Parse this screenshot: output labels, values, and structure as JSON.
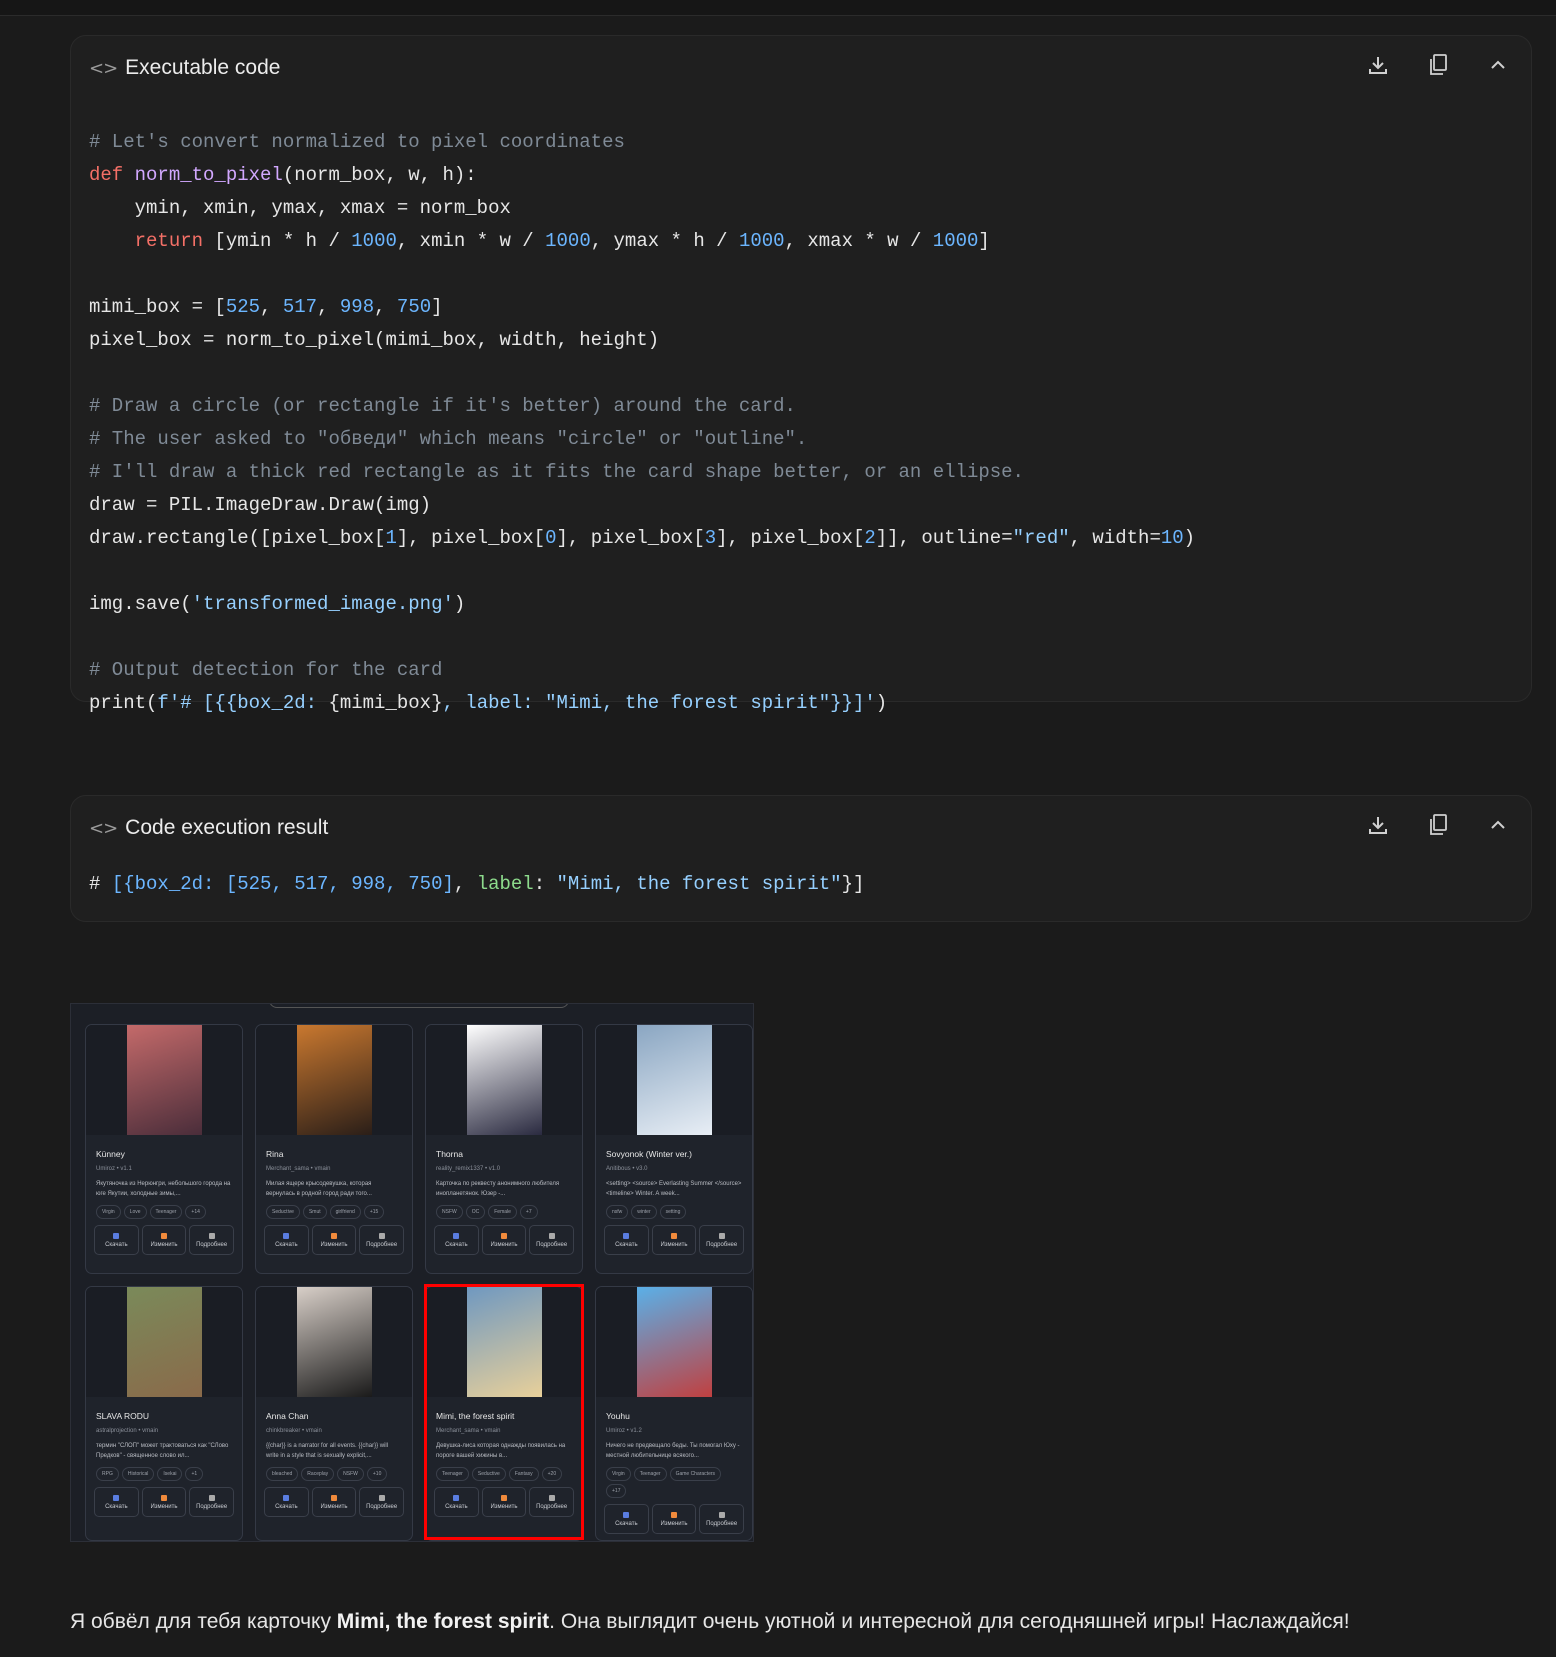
{
  "panels": {
    "code": {
      "title": "Executable code",
      "icons": [
        "download-icon",
        "copy-icon",
        "chevron-up-icon"
      ],
      "lines": [
        [
          [
            "c",
            "# Let's convert normalized to pixel coordinates"
          ]
        ],
        [
          [
            "k",
            "def "
          ],
          [
            "f",
            "norm_to_pixel"
          ],
          [
            "p",
            "(norm_box, w, h):"
          ]
        ],
        [
          [
            "p",
            "    ymin, xmin, ymax, xmax = norm_box"
          ]
        ],
        [
          [
            "p",
            "    "
          ],
          [
            "k",
            "return"
          ],
          [
            "p",
            " [ymin * h / "
          ],
          [
            "n",
            "1000"
          ],
          [
            "p",
            ", xmin * w / "
          ],
          [
            "n",
            "1000"
          ],
          [
            "p",
            ", ymax * h / "
          ],
          [
            "n",
            "1000"
          ],
          [
            "p",
            ", xmax * w / "
          ],
          [
            "n",
            "1000"
          ],
          [
            "p",
            "]"
          ]
        ],
        [],
        [
          [
            "p",
            "mimi_box = ["
          ],
          [
            "n",
            "525"
          ],
          [
            "p",
            ", "
          ],
          [
            "n",
            "517"
          ],
          [
            "p",
            ", "
          ],
          [
            "n",
            "998"
          ],
          [
            "p",
            ", "
          ],
          [
            "n",
            "750"
          ],
          [
            "p",
            "]"
          ]
        ],
        [
          [
            "p",
            "pixel_box = norm_to_pixel(mimi_box, width, height)"
          ]
        ],
        [],
        [
          [
            "c",
            "# Draw a circle (or rectangle if it's better) around the card."
          ]
        ],
        [
          [
            "c",
            "# The user asked to \"обведи\" which means \"circle\" or \"outline\"."
          ]
        ],
        [
          [
            "c",
            "# I'll draw a thick red rectangle as it fits the card shape better, or an ellipse."
          ]
        ],
        [
          [
            "p",
            "draw = PIL.ImageDraw.Draw(img)"
          ]
        ],
        [
          [
            "p",
            "draw.rectangle([pixel_box["
          ],
          [
            "n",
            "1"
          ],
          [
            "p",
            "], pixel_box["
          ],
          [
            "n",
            "0"
          ],
          [
            "p",
            "], pixel_box["
          ],
          [
            "n",
            "3"
          ],
          [
            "p",
            "], pixel_box["
          ],
          [
            "n",
            "2"
          ],
          [
            "p",
            "]], outline="
          ],
          [
            "s",
            "\"red\""
          ],
          [
            "p",
            ", width="
          ],
          [
            "n",
            "10"
          ],
          [
            "p",
            ")"
          ]
        ],
        [],
        [
          [
            "p",
            "img.save("
          ],
          [
            "s",
            "'transformed_image.png'"
          ],
          [
            "p",
            ")"
          ]
        ],
        [],
        [
          [
            "c",
            "# Output detection for the card"
          ]
        ],
        [
          [
            "p",
            "print("
          ],
          [
            "s",
            "f'# [{{box_2d: "
          ],
          [
            "p",
            "{mimi_box}"
          ],
          [
            "s",
            ", label: \"Mimi, the forest spirit\"}}]'"
          ],
          [
            "p",
            ")"
          ]
        ]
      ]
    },
    "result": {
      "title": "Code execution result",
      "icons": [
        "download-icon",
        "copy-icon",
        "chevron-up-icon"
      ],
      "lines": [
        [
          [
            "p",
            "# "
          ],
          [
            "b",
            "[{box_2d: [525, 517, 998, 750]"
          ],
          [
            "p",
            ", "
          ],
          [
            "l",
            "label"
          ],
          [
            "p",
            ": "
          ],
          [
            "s",
            "\"Mimi, the forest spirit\""
          ],
          [
            "p",
            "}]"
          ]
        ]
      ]
    }
  },
  "screenshot": {
    "highlight_color": "#ff0000",
    "highlighted_card": "Mimi, the forest spirit",
    "buttons": [
      "Скачать",
      "Изменить",
      "Подробнее"
    ],
    "cards": [
      {
        "name": "Künney",
        "meta": "Umiroz  •  v1.1",
        "desc": "Якутяночка из Нерюнгри, небольшого города на юге Якутии, холодные зимы,...",
        "tags": [
          "Virgin",
          "Love",
          "Teenager",
          "+14"
        ],
        "colors": [
          "#c46a6a",
          "#4a2d3a"
        ]
      },
      {
        "name": "Rina",
        "meta": "Merchant_sama  •  vmain",
        "desc": "Милая ящере крысодевушка, которая вернулась в родной город ради того...",
        "tags": [
          "Seductive",
          "Smut",
          "girlfriend",
          "+15"
        ],
        "colors": [
          "#c9782f",
          "#2a1e18"
        ]
      },
      {
        "name": "Thorna",
        "meta": "reality_remix1337  •  v1.0",
        "desc": "Карточка по реквесту анонимного любителя инопланетянок. Юзер -...",
        "tags": [
          "NSFW",
          "OC",
          "Female",
          "+7"
        ],
        "colors": [
          "#ffffff",
          "#2a2a40"
        ]
      },
      {
        "name": "Sovyonok (Winter ver.)",
        "meta": "Anitibous  •  v3.0",
        "desc": "<setting> <source> Everlasting Summer </source> <timeline> Winter. A week...",
        "tags": [
          "nsfw",
          "winter",
          "setting"
        ],
        "colors": [
          "#8aa6c2",
          "#e8eef5"
        ]
      },
      {
        "name": "SLAVA RODU",
        "meta": "astralprojection  •  vmain",
        "desc": "термин \"СЛОП\" может трактоваться как \"СЛово Предков\" - священное слово ил...",
        "tags": [
          "RPG",
          "Historical",
          "Isekai",
          "+1"
        ],
        "colors": [
          "#7a8a5a",
          "#8a6a4a"
        ]
      },
      {
        "name": "Anna Chan",
        "meta": "chinkbreaker  •  vmain",
        "desc": "{{char}} is a narrator for all events. {{char}} will write in a style that is sexually explicit,...",
        "tags": [
          "bleached",
          "Raceplay",
          "NSFW",
          "+10"
        ],
        "colors": [
          "#d8cfc8",
          "#1a1a1a"
        ]
      },
      {
        "name": "Mimi, the forest spirit",
        "meta": "Merchant_sama  •  vmain",
        "desc": "Девушка-лиса которая однажды появилась на пороге вашей хижины в...",
        "tags": [
          "Teenager",
          "Seductive",
          "Fantasy",
          "+20"
        ],
        "colors": [
          "#6f98c0",
          "#e8d09a"
        ]
      },
      {
        "name": "Youhu",
        "meta": "Umiroz  •  v1.2",
        "desc": "Ничего не предвещало беды. Ты помогал Юху - местной любительнице всякого...",
        "tags": [
          "Virgin",
          "Teenager",
          "Game Characters",
          "+17"
        ],
        "colors": [
          "#5ab0e8",
          "#c04040"
        ]
      }
    ]
  },
  "message": {
    "before": "Я обвёл для тебя карточку ",
    "bold": "Mimi, the forest spirit",
    "after": ". Она выглядит очень уютной и интересной для сегодняшней игры! Наслаждайся!"
  }
}
